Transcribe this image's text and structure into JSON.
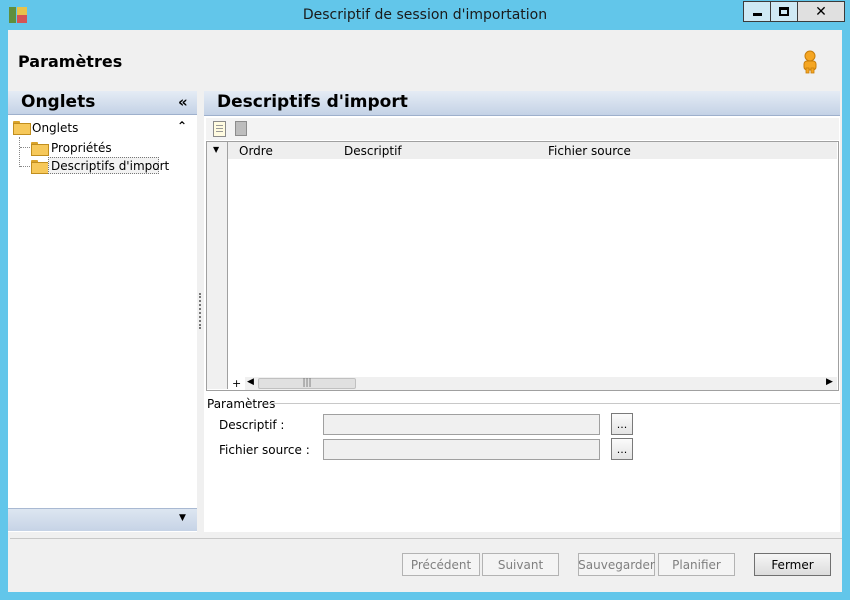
{
  "window": {
    "title": "Descriptif de session d'importation",
    "controls": {
      "minimize": "minimize-icon",
      "maximize": "maximize-icon",
      "close": "✕"
    }
  },
  "header": {
    "title": "Paramètres",
    "icon": "user-icon"
  },
  "left_panel": {
    "title": "Onglets",
    "collapse_glyph": "«",
    "root": {
      "label": "Onglets",
      "toggle_glyph": "⌃"
    },
    "items": [
      {
        "label": "Propriétés",
        "icon": "folder-icon",
        "selected": false
      },
      {
        "label": "Descriptifs d'import",
        "icon": "folder-open-icon",
        "selected": true
      }
    ],
    "footer_arrow": "▼"
  },
  "right_panel": {
    "title": "Descriptifs d'import",
    "toolbar": {
      "new_icon": "new-document-icon",
      "delete_icon": "delete-icon"
    },
    "grid": {
      "sort_glyph": "▼",
      "columns": [
        "Ordre",
        "Descriptif",
        "Fichier source"
      ],
      "rows": [],
      "add_glyph": "+",
      "scroll_left": "◀",
      "scroll_thumb": "|||",
      "scroll_right": "▶"
    },
    "params": {
      "group_label": "Paramètres",
      "descriptif": {
        "label": "Descriptif :",
        "value": "",
        "browse": "..."
      },
      "fichier_source": {
        "label": "Fichier source :",
        "value": "",
        "browse": "..."
      }
    }
  },
  "buttons": {
    "previous": "Précédent",
    "next": "Suivant",
    "save": "Sauvegarder",
    "schedule": "Planifier",
    "close": "Fermer"
  },
  "colors": {
    "titlebar": "#62c6ea",
    "panel_header": "#c4d2e6",
    "client": "#f0f0f0"
  }
}
